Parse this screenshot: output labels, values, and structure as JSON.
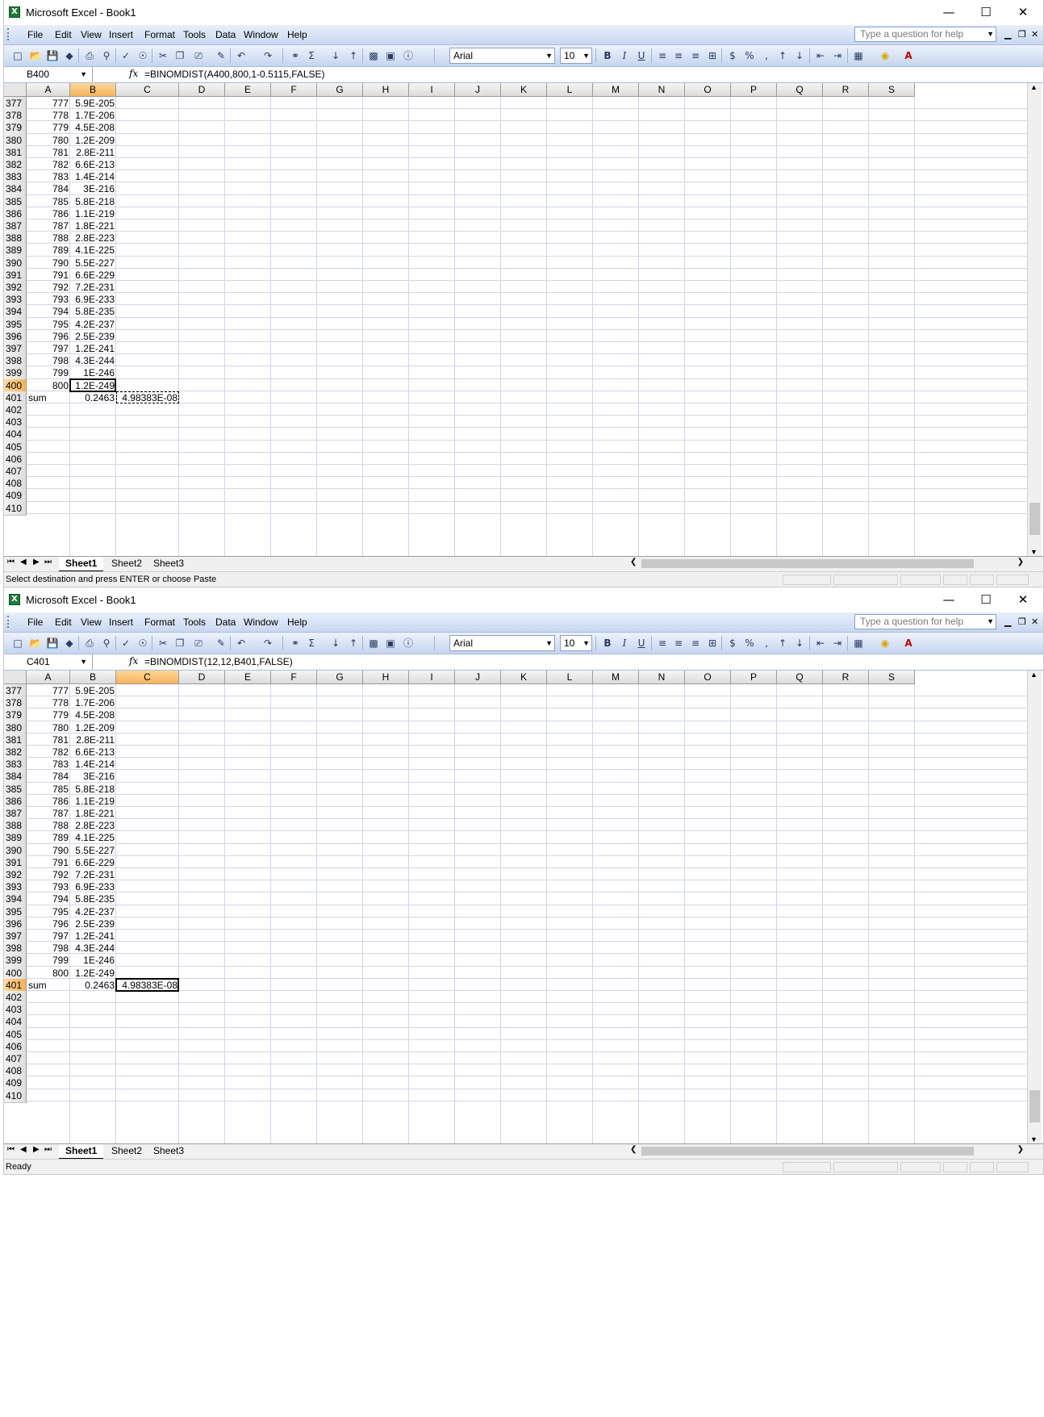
{
  "colors": {
    "accent": "#f4b35a",
    "title_icon": "#1f7a3a"
  },
  "common": {
    "app_title": "Microsoft Excel - Book1",
    "app_icon_glyph": "X",
    "menus": [
      "File",
      "Edit",
      "View",
      "Insert",
      "Format",
      "Tools",
      "Data",
      "Window",
      "Help"
    ],
    "help_placeholder": "Type a question for help",
    "font_name": "Arial",
    "font_size": "10",
    "fx_label": "fx",
    "columns": [
      "A",
      "B",
      "C",
      "D",
      "E",
      "F",
      "G",
      "H",
      "I",
      "J",
      "K",
      "L",
      "M",
      "N",
      "O",
      "P",
      "Q",
      "R",
      "S"
    ],
    "sheets": [
      "Sheet1",
      "Sheet2",
      "Sheet3"
    ],
    "rows": [
      {
        "row": "377",
        "a": "777",
        "b": "5.9E-205",
        "c": ""
      },
      {
        "row": "378",
        "a": "778",
        "b": "1.7E-206",
        "c": ""
      },
      {
        "row": "379",
        "a": "779",
        "b": "4.5E-208",
        "c": ""
      },
      {
        "row": "380",
        "a": "780",
        "b": "1.2E-209",
        "c": ""
      },
      {
        "row": "381",
        "a": "781",
        "b": "2.8E-211",
        "c": ""
      },
      {
        "row": "382",
        "a": "782",
        "b": "6.6E-213",
        "c": ""
      },
      {
        "row": "383",
        "a": "783",
        "b": "1.4E-214",
        "c": ""
      },
      {
        "row": "384",
        "a": "784",
        "b": "3E-216",
        "c": ""
      },
      {
        "row": "385",
        "a": "785",
        "b": "5.8E-218",
        "c": ""
      },
      {
        "row": "386",
        "a": "786",
        "b": "1.1E-219",
        "c": ""
      },
      {
        "row": "387",
        "a": "787",
        "b": "1.8E-221",
        "c": ""
      },
      {
        "row": "388",
        "a": "788",
        "b": "2.8E-223",
        "c": ""
      },
      {
        "row": "389",
        "a": "789",
        "b": "4.1E-225",
        "c": ""
      },
      {
        "row": "390",
        "a": "790",
        "b": "5.5E-227",
        "c": ""
      },
      {
        "row": "391",
        "a": "791",
        "b": "6.6E-229",
        "c": ""
      },
      {
        "row": "392",
        "a": "792",
        "b": "7.2E-231",
        "c": ""
      },
      {
        "row": "393",
        "a": "793",
        "b": "6.9E-233",
        "c": ""
      },
      {
        "row": "394",
        "a": "794",
        "b": "5.8E-235",
        "c": ""
      },
      {
        "row": "395",
        "a": "795",
        "b": "4.2E-237",
        "c": ""
      },
      {
        "row": "396",
        "a": "796",
        "b": "2.5E-239",
        "c": ""
      },
      {
        "row": "397",
        "a": "797",
        "b": "1.2E-241",
        "c": ""
      },
      {
        "row": "398",
        "a": "798",
        "b": "4.3E-244",
        "c": ""
      },
      {
        "row": "399",
        "a": "799",
        "b": "1E-246",
        "c": ""
      },
      {
        "row": "400",
        "a": "800",
        "b": "1.2E-249",
        "c": ""
      },
      {
        "row": "401",
        "a": "sum",
        "b": "0.2463",
        "c": "4.98383E-08"
      },
      {
        "row": "402",
        "a": "",
        "b": "",
        "c": ""
      },
      {
        "row": "403",
        "a": "",
        "b": "",
        "c": ""
      },
      {
        "row": "404",
        "a": "",
        "b": "",
        "c": ""
      },
      {
        "row": "405",
        "a": "",
        "b": "",
        "c": ""
      },
      {
        "row": "406",
        "a": "",
        "b": "",
        "c": ""
      },
      {
        "row": "407",
        "a": "",
        "b": "",
        "c": ""
      },
      {
        "row": "408",
        "a": "",
        "b": "",
        "c": ""
      },
      {
        "row": "409",
        "a": "",
        "b": "",
        "c": ""
      },
      {
        "row": "410",
        "a": "",
        "b": "",
        "c": ""
      }
    ]
  },
  "windows": [
    {
      "name_box": "B400",
      "formula": "=BINOMDIST(A400,800,1-0.5115,FALSE)",
      "selected_column": "B",
      "selected_row": "400",
      "status": "Select destination and press ENTER or choose Paste"
    },
    {
      "name_box": "C401",
      "formula": "=BINOMDIST(12,12,B401,FALSE)",
      "selected_column": "C",
      "selected_row": "401",
      "status": "Ready"
    }
  ]
}
